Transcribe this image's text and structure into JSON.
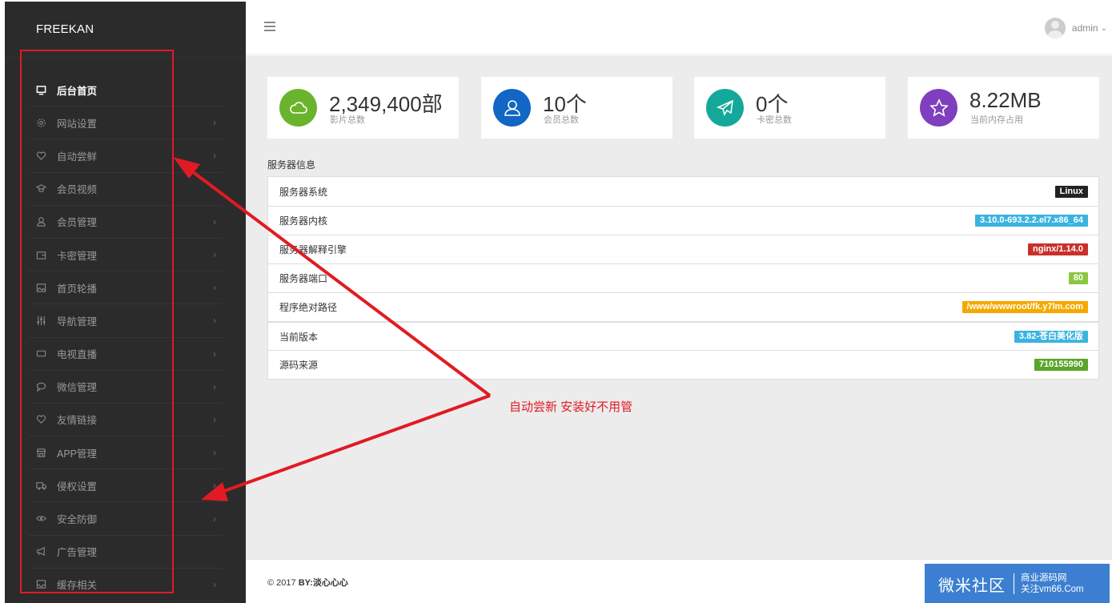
{
  "sidebar": {
    "brand": "FREEKAN",
    "items": [
      {
        "label": "后台首页",
        "icon": "monitor-icon",
        "active": true
      },
      {
        "label": "网站设置",
        "icon": "gear-icon"
      },
      {
        "label": "自动尝鲜",
        "icon": "heart-icon"
      },
      {
        "label": "会员视频",
        "icon": "graduation-cap-icon"
      },
      {
        "label": "会员管理",
        "icon": "user-icon"
      },
      {
        "label": "卡密管理",
        "icon": "wallet-icon"
      },
      {
        "label": "首页轮播",
        "icon": "image-icon"
      },
      {
        "label": "导航管理",
        "icon": "sliders-icon"
      },
      {
        "label": "电视直播",
        "icon": "video-camera-icon"
      },
      {
        "label": "微信管理",
        "icon": "chat-bubble-icon"
      },
      {
        "label": "友情链接",
        "icon": "heart-icon"
      },
      {
        "label": "APP管理",
        "icon": "store-icon"
      },
      {
        "label": "侵权设置",
        "icon": "truck-icon"
      },
      {
        "label": "安全防御",
        "icon": "eye-icon"
      },
      {
        "label": "广告管理",
        "icon": "megaphone-icon"
      },
      {
        "label": "缓存相关",
        "icon": "inbox-icon"
      }
    ]
  },
  "topbar": {
    "user": "admin",
    "menu_icon": "hamburger-icon"
  },
  "stats": [
    {
      "value": "2,349,400部",
      "caption": "影片总数",
      "color": "#6ab42d",
      "icon": "cloud-icon"
    },
    {
      "value": "10个",
      "caption": "会员总数",
      "color": "#1266c4",
      "icon": "user-icon"
    },
    {
      "value": "0个",
      "caption": "卡密总数",
      "color": "#14a89a",
      "icon": "paper-plane-icon"
    },
    {
      "value": "8.22MB",
      "caption": "当前内存占用",
      "color": "#7f3fbf",
      "icon": "star-icon"
    }
  ],
  "server": {
    "title": "服务器信息",
    "rows": [
      {
        "label": "服务器系统",
        "value": "Linux",
        "color": "#222222"
      },
      {
        "label": "服务器内核",
        "value": "3.10.0-693.2.2.el7.x86_64",
        "color": "#3ab3e0"
      },
      {
        "label": "服务器解释引擎",
        "value": "nginx/1.14.0",
        "color": "#c9302c"
      },
      {
        "label": "服务器端口",
        "value": "80",
        "color": "#8cc63f"
      },
      {
        "label": "程序绝对路径",
        "value": "/www/wwwroot/fk.y7lm.com",
        "color": "#f5a900"
      },
      {
        "label": "当前版本",
        "value": "3.82-苍白美化版",
        "color": "#3ab3e0"
      },
      {
        "label": "源码来源",
        "value": "710155990",
        "color": "#5aa52b"
      }
    ]
  },
  "footer": {
    "copy": "© 2017 ",
    "by": "BY:淡心心心"
  },
  "watermark": {
    "main": "微米社区",
    "line1": "商业源码网",
    "line2": "关注vm66.Com"
  },
  "annotation": {
    "text": "自动尝新  安装好不用管"
  }
}
